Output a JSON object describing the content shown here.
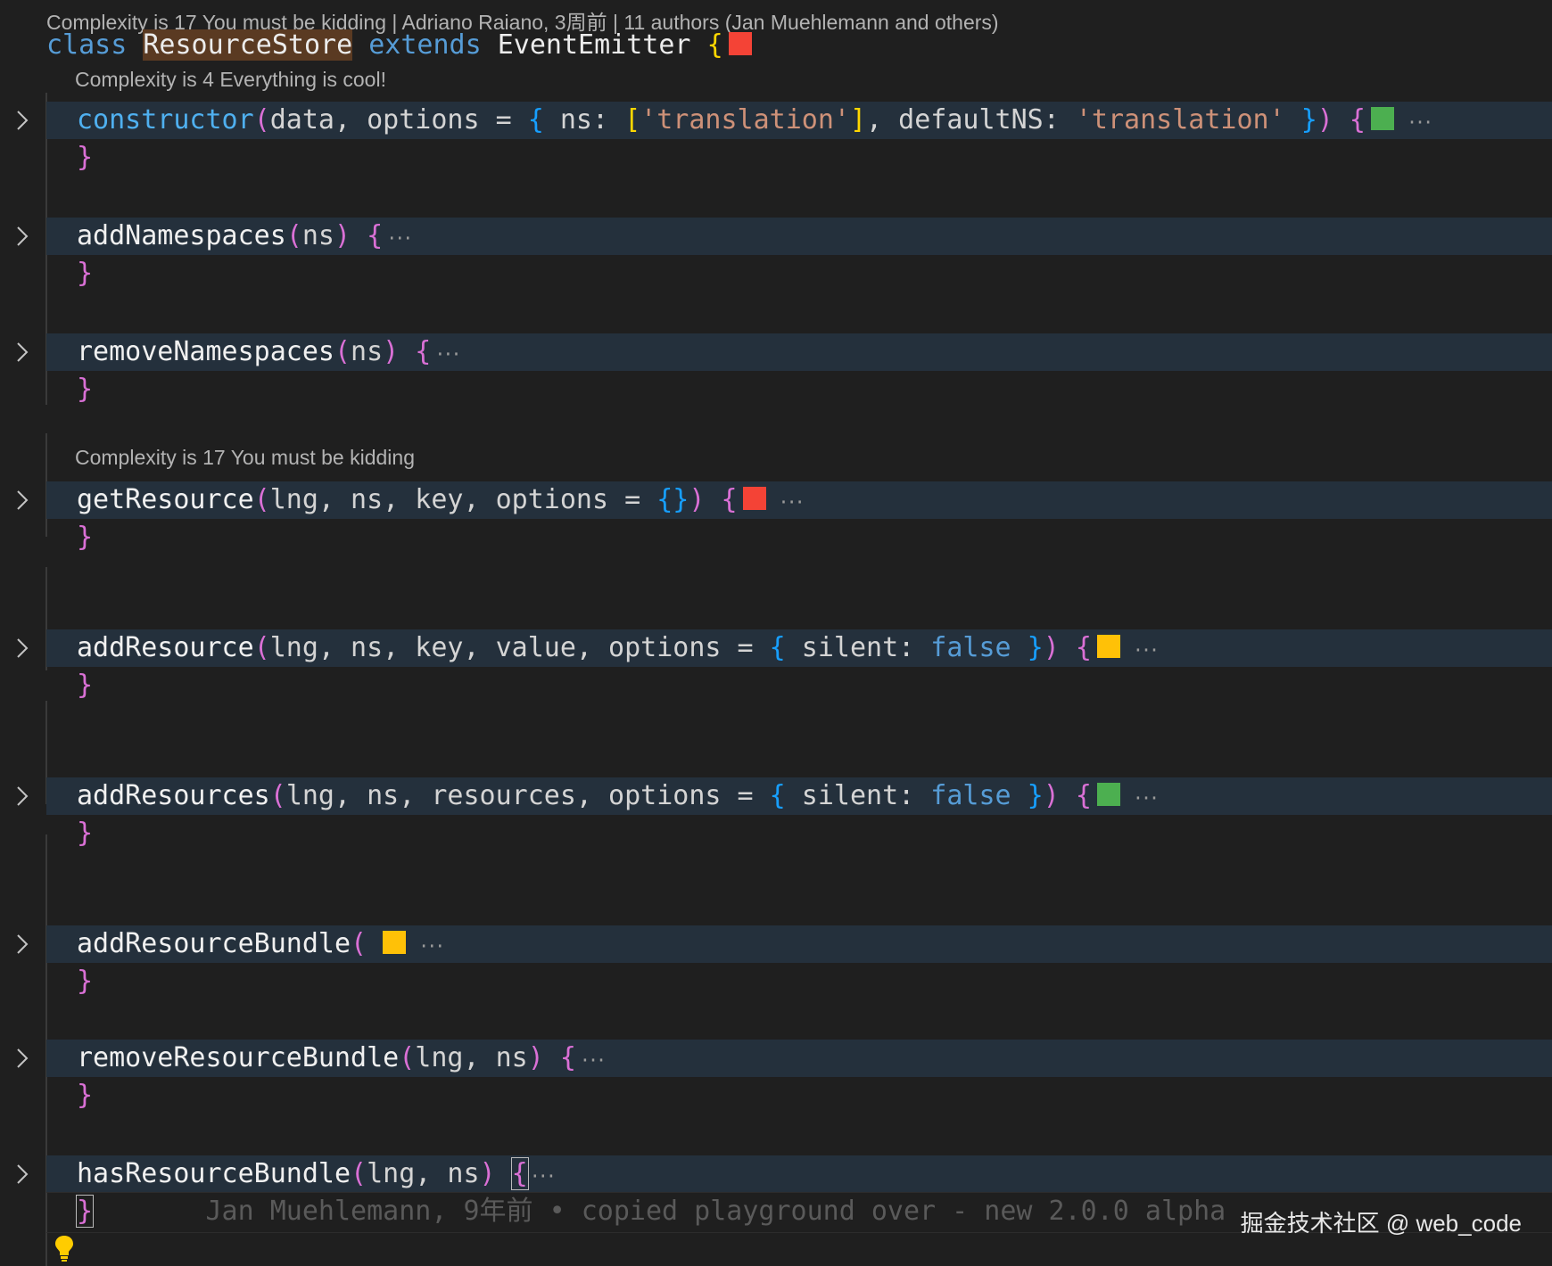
{
  "top_lens": "Complexity is 17 You must be kidding | Adriano Raiano, 3周前 | 11 authors (Jan Muehlemann and others)",
  "class_line": {
    "kw_class": "class",
    "name": "ResourceStore",
    "kw_extends": "extends",
    "parent": "EventEmitter",
    "brace": "{",
    "badge_color": "#f44336"
  },
  "lenses": {
    "constructor": "Complexity is 4 Everything is cool!",
    "getResource": "Complexity is 17 You must be kidding"
  },
  "methods": [
    {
      "name": "constructor",
      "badge_color": "#4caf50"
    },
    {
      "name": "addNamespaces",
      "params": "ns"
    },
    {
      "name": "removeNamespaces",
      "params": "ns"
    },
    {
      "name": "getResource",
      "params": "lng, ns, key, options = ",
      "badge_color": "#f44336"
    },
    {
      "name": "addResource",
      "params": "lng, ns, key, value, options = ",
      "badge_color": "#ffc107"
    },
    {
      "name": "addResources",
      "params": "lng, ns, resources, options = ",
      "badge_color": "#4caf50"
    },
    {
      "name": "addResourceBundle",
      "badge_color": "#ffc107"
    },
    {
      "name": "removeResourceBundle",
      "params": "lng, ns"
    },
    {
      "name": "hasResourceBundle",
      "params": "lng, ns"
    }
  ],
  "tokens": {
    "ctor_params_a": "data, options = ",
    "ns_key": " ns: ",
    "str_translation": "'translation'",
    "default_ns": ", defaultNS: ",
    "silent": " silent: ",
    "false": "false",
    "empty_obj": "{}",
    "brace_open": "{",
    "brace_close": "}",
    "paren_open": "(",
    "paren_close": ")",
    "ellipsis": "···"
  },
  "blame": "Jan Muehlemann, 9年前 • copied playground over - new 2.0.0 alpha",
  "watermark": "掘金技术社区 @ web_code",
  "icons": {
    "fold": "chevron-right-icon",
    "bulb": "lightbulb-icon"
  }
}
